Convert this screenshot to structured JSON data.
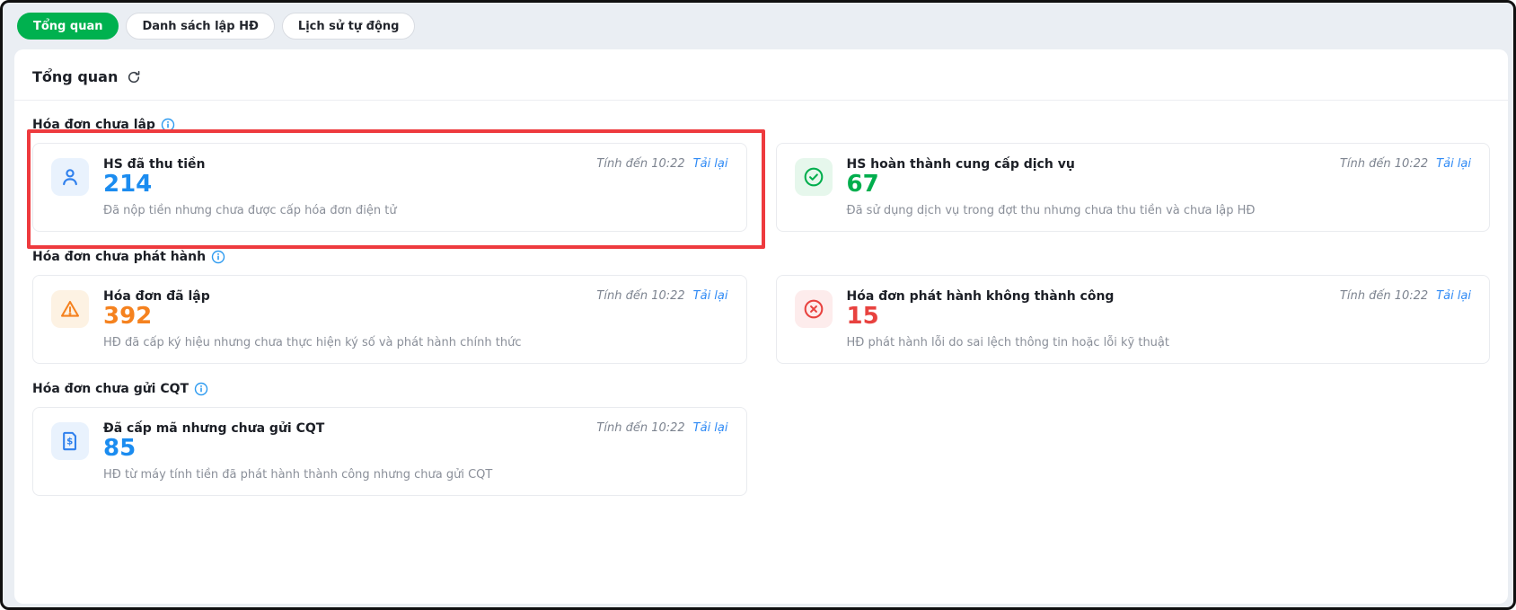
{
  "tabs": [
    {
      "label": "Tổng quan",
      "active": true
    },
    {
      "label": "Danh sách lập HĐ",
      "active": false
    },
    {
      "label": "Lịch sử tự động",
      "active": false
    }
  ],
  "overview": {
    "title": "Tổng quan"
  },
  "colors": {
    "active_tab_green": "#00b14f",
    "blue_value": "#1b8cf0",
    "green_value": "#00ae4d",
    "orange_value": "#f5821f",
    "red_value": "#e8423f",
    "reload_link_blue": "#2f8af5",
    "highlight_red": "#ee3a3e"
  },
  "sections": [
    {
      "label": "Hóa đơn chưa lập",
      "cards": [
        {
          "icon": "user-icon",
          "title": "HS đã thu tiền",
          "value": "214",
          "desc": "Đã nộp tiền nhưng chưa được cấp hóa đơn điện tử",
          "as_of": "Tính đến 10:22",
          "reload_label": "Tải lại",
          "highlighted": true
        },
        {
          "icon": "check-circle-icon",
          "title": "HS hoàn thành cung cấp dịch vụ",
          "value": "67",
          "desc": "Đã sử dụng dịch vụ trong đợt thu nhưng chưa thu tiền và chưa lập HĐ",
          "as_of": "Tính đến 10:22",
          "reload_label": "Tải lại",
          "highlighted": false
        }
      ]
    },
    {
      "label": "Hóa đơn chưa phát hành",
      "cards": [
        {
          "icon": "warning-triangle-icon",
          "title": "Hóa đơn đã lập",
          "value": "392",
          "desc": "HĐ đã cấp ký hiệu nhưng chưa thực hiện ký số và phát hành chính thức",
          "as_of": "Tính đến 10:22",
          "reload_label": "Tải lại",
          "highlighted": false
        },
        {
          "icon": "x-circle-icon",
          "title": "Hóa đơn phát hành không thành công",
          "value": "15",
          "desc": "HĐ phát hành lỗi do sai lệch thông tin hoặc lỗi kỹ thuật",
          "as_of": "Tính đến 10:22",
          "reload_label": "Tải lại",
          "highlighted": false
        }
      ]
    },
    {
      "label": "Hóa đơn chưa gửi CQT",
      "cards": [
        {
          "icon": "invoice-dollar-icon",
          "title": "Đã cấp mã nhưng chưa gửi CQT",
          "value": "85",
          "desc": "HĐ từ máy tính tiền đã phát hành thành công nhưng chưa gửi CQT",
          "as_of": "Tính đến 10:22",
          "reload_label": "Tải lại",
          "highlighted": false
        }
      ]
    }
  ]
}
